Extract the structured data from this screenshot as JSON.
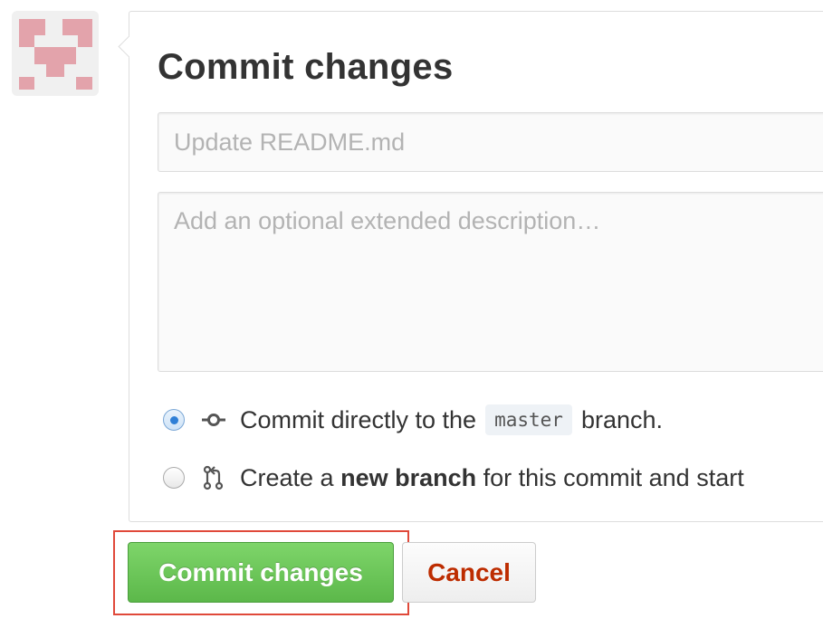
{
  "commit_form": {
    "title": "Commit changes",
    "summary_placeholder": "Update README.md",
    "description_placeholder": "Add an optional extended description…",
    "options": {
      "direct": {
        "prefix": "Commit directly to the",
        "branch": "master",
        "suffix": "branch.",
        "selected": true,
        "icon": "git-commit-icon"
      },
      "new_branch": {
        "prefix": "Create a",
        "bold": "new branch",
        "suffix": "for this commit and start",
        "selected": false,
        "icon": "git-pull-request-icon"
      }
    }
  },
  "actions": {
    "commit_label": "Commit changes",
    "cancel_label": "Cancel"
  },
  "colors": {
    "commit_button": "#6cc644",
    "cancel_text": "#bd2c00",
    "highlight_border": "#e0493a",
    "avatar_pink": "#e3a3ab"
  }
}
